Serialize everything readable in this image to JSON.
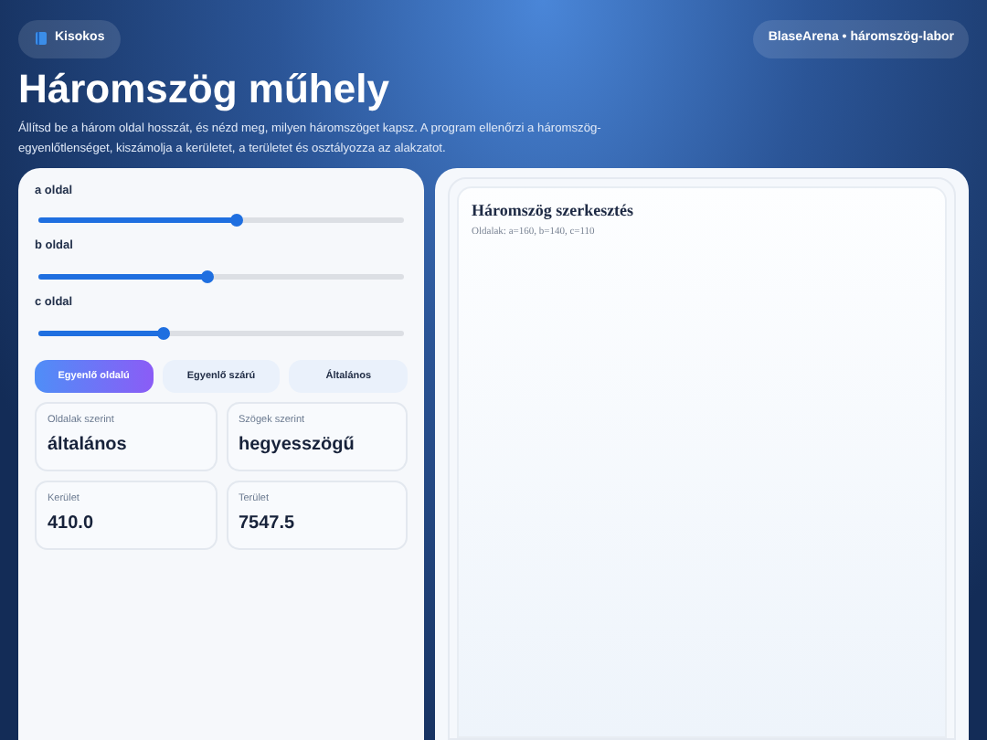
{
  "header": {
    "guide_button": "Kisokos",
    "brand": "BlaseArena • háromszög-labor",
    "title": "Háromszög műhely",
    "description": "Állítsd be a három oldal hosszát, és nézd meg, milyen háromszöget kapsz. A program ellenőrzi a háromszög-egyenlőtlenséget, kiszámolja a kerületet, a területet és osztályozza az alakzatot."
  },
  "sliders": [
    {
      "label": "a oldal",
      "level": 0.54
    },
    {
      "label": "b oldal",
      "level": 0.46
    },
    {
      "label": "c oldal",
      "level": 0.34
    }
  ],
  "presets": [
    {
      "label": "Egyenlő oldalú",
      "selected": true
    },
    {
      "label": "Egyenlő szárú",
      "selected": false
    },
    {
      "label": "Általános",
      "selected": false
    }
  ],
  "stats": [
    {
      "label": "Oldalak szerint",
      "value": "általános"
    },
    {
      "label": "Szögek szerint",
      "value": "hegyesszögű"
    },
    {
      "label": "Kerület",
      "value": "410.0"
    },
    {
      "label": "Terület",
      "value": "7547.5"
    }
  ],
  "canvas": {
    "title": "Háromszög szerkesztés",
    "subtitle": "Oldalak: a=160, b=140, c=110"
  }
}
